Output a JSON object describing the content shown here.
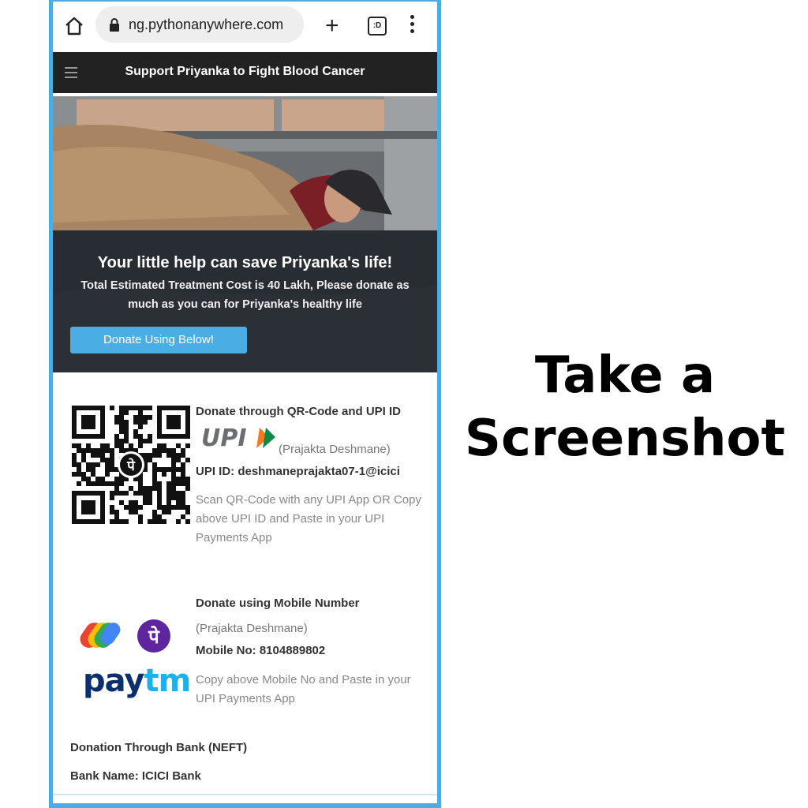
{
  "browser": {
    "url": "ng.pythonanywhere.com",
    "tabs_count": ":D"
  },
  "site": {
    "title": "Support Priyanka to Fight Blood Cancer"
  },
  "hero": {
    "headline": "Your little help can save Priyanka's life!",
    "subtext": "Total Estimated Treatment Cost is 40 Lakh, Please donate as much as you can for Priyanka's healthy life",
    "button_label": "Donate Using Below!"
  },
  "qr_section": {
    "title": "Donate through QR-Code and UPI ID",
    "logo_text": "UPI",
    "payee": "(Prajakta Deshmane)",
    "upi_id": "UPI ID: deshmaneprajakta07-1@icici",
    "instructions": "Scan QR-Code with any UPI App OR Copy above UPI ID and Paste in your UPI Payments App",
    "qr_badge": "पे"
  },
  "mobile_section": {
    "title": "Donate using Mobile Number",
    "payee": "(Prajakta Deshmane)",
    "mobile_no": "Mobile No: 8104889802",
    "instructions": "Copy above Mobile No and Paste in your UPI Payments App",
    "phonepe_glyph": "पे",
    "paytm_pay": "pay",
    "paytm_tm": "tm"
  },
  "bank_section": {
    "title": "Donation Through Bank (NEFT)",
    "bank_name": "Bank Name: ICICI Bank"
  },
  "caption": {
    "line1": "Take a",
    "line2": "Screenshot"
  },
  "colors": {
    "frame": "#4aaee4",
    "header_bg": "#222222",
    "button": "#4aaee4",
    "paytm_dark": "#0b2e6e",
    "paytm_light": "#1eb0e8",
    "phonepe": "#5f259f"
  }
}
